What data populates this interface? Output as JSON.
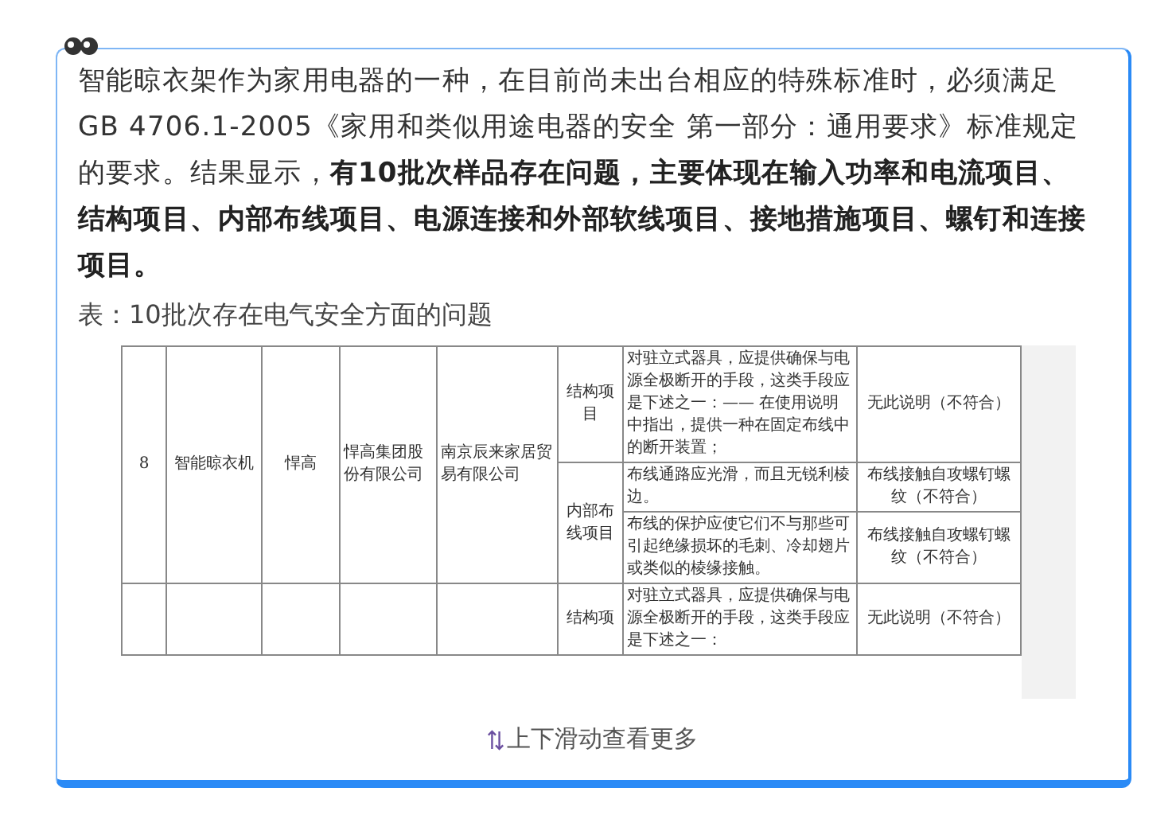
{
  "article": {
    "paragraph": "智能晾衣架作为家用电器的一种，在目前尚未出台相应的特殊标准时，必须满足GB 4706.1-2005《家用和类似用途电器的安全 第一部分：通用要求》标准规定的要求。结果显示，**有10批次样品存在问题，主要体现在输入功率和电流项目、结构项目、内部布线项目、电源连接和外部软线项目、接地措施项目、螺钉和连接项目。**",
    "caption": "表：10批次存在电气安全方面的问题"
  },
  "table": {
    "rows": [
      {
        "number": "8",
        "product": "智能晾衣机",
        "brand": "悍高",
        "manufacturer": "悍高集团股份有限公司",
        "seller": "南京辰来家居贸易有限公司",
        "groups": [
          {
            "item": "结构项目",
            "checks": [
              {
                "requirement": "对驻立式器具，应提供确保与电源全极断开的手段，这类手段应是下述之一：—— 在使用说明中指出，提供一种在固定布线中的断开装置；",
                "result": "无此说明（不符合）"
              }
            ]
          },
          {
            "item": "内部布线项目",
            "checks": [
              {
                "requirement": "布线通路应光滑，而且无锐利棱边。",
                "result": "布线接触自攻螺钉螺纹（不符合）"
              },
              {
                "requirement": "布线的保护应使它们不与那些可引起绝缘损坏的毛刺、冷却翅片或类似的棱缘接触。",
                "result": "布线接触自攻螺钉螺纹（不符合）"
              }
            ]
          }
        ]
      },
      {
        "groups": [
          {
            "item": "结构项",
            "checks": [
              {
                "requirement": "对驻立式器具，应提供确保与电源全极断开的手段，这类手段应是下述之一：",
                "result": "无此说明（不符合）"
              }
            ]
          }
        ]
      }
    ]
  },
  "footer": {
    "hint": "上下滑动查看更多"
  }
}
